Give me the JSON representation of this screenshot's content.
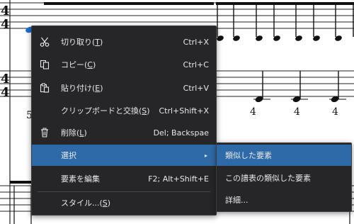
{
  "score": {
    "time_signature": [
      "4",
      "4"
    ],
    "fingerings_row2": [
      "5",
      "4",
      "4",
      "4"
    ]
  },
  "context_menu": {
    "items": [
      {
        "icon": "scissors-icon",
        "text": "切り取り",
        "mnemonic": "T",
        "shortcut": "Ctrl+X"
      },
      {
        "icon": "copy-icon",
        "text": "コピー",
        "mnemonic": "C",
        "shortcut": "Ctrl+C"
      },
      {
        "icon": "paste-icon",
        "text": "貼り付け",
        "mnemonic": "E",
        "shortcut": "Ctrl+V"
      },
      {
        "icon": "",
        "text": "クリップボードと交換",
        "mnemonic": "S",
        "shortcut": "Ctrl+Shift+X"
      },
      {
        "icon": "trash-icon",
        "text": "削除",
        "mnemonic": "L",
        "shortcut": "Del; Backspae"
      },
      {
        "icon": "",
        "text": "選択",
        "mnemonic": "",
        "shortcut": "",
        "submenu_arrow": "▸"
      },
      {
        "icon": "",
        "text": "要素を編集",
        "mnemonic": "",
        "shortcut": "F2; Alt+Shift+E"
      },
      {
        "icon": "",
        "text": "スタイル...",
        "mnemonic": "S",
        "shortcut": ""
      }
    ]
  },
  "submenu": {
    "items": [
      {
        "text": "類似した要素"
      },
      {
        "text": "この譜表の類似した要素"
      },
      {
        "text": "詳細..."
      }
    ]
  },
  "colors": {
    "menu_bg": "#262628",
    "highlight": "#2e6aa8",
    "menu_text": "#e8e8e8",
    "selected_note": "#1a6ed8"
  }
}
